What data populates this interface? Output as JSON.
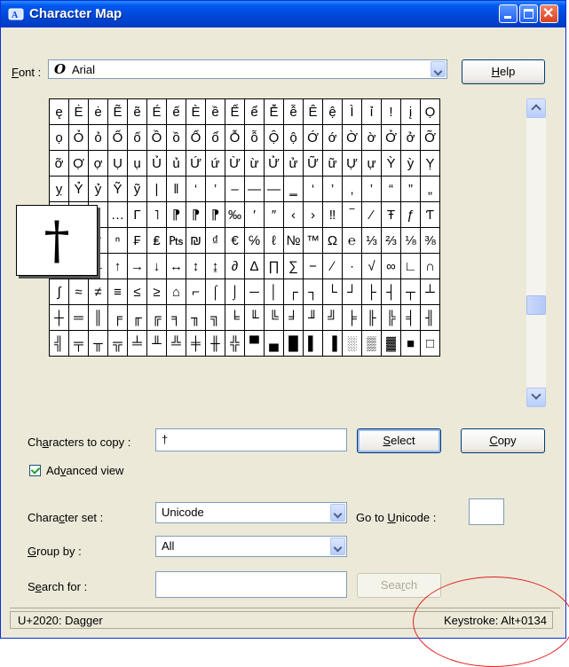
{
  "window": {
    "title": "Character Map",
    "minimize_icon": "minimize-icon",
    "maximize_icon": "maximize-icon",
    "close_icon": "close-icon"
  },
  "font": {
    "label_underlined": "F",
    "label_rest": "ont :",
    "value": "Arial",
    "help_button": {
      "underlined": "H",
      "rest": "elp"
    }
  },
  "grid": {
    "rows": [
      [
        "ę",
        "Ė",
        "ė",
        "Ẽ",
        "ẽ",
        "É",
        "ế",
        "È",
        "ề",
        "Ể",
        "ể",
        "Ễ",
        "ễ",
        "Ê",
        "ệ",
        "Ì",
        "ỉ",
        "!",
        "į",
        "Ọ"
      ],
      [
        "ọ",
        "Ỏ",
        "ỏ",
        "Ố",
        "ố",
        "Ồ",
        "ồ",
        "Ổ",
        "ổ",
        "Ỗ",
        "ỗ",
        "Ộ",
        "ộ",
        "Ớ",
        "ớ",
        "Ờ",
        "ờ",
        "Ở",
        "ở",
        "Ỡ"
      ],
      [
        "ỡ",
        "Ợ",
        "ợ",
        "Ụ",
        "ụ",
        "Ủ",
        "ủ",
        "Ứ",
        "ứ",
        "Ừ",
        "ừ",
        "Ử",
        "ử",
        "Ữ",
        "ữ",
        "Ự",
        "ự",
        "Ỳ",
        "ỳ",
        "Ỵ"
      ],
      [
        "ỵ",
        "Ỷ",
        "ỷ",
        "Ỹ",
        "ỹ",
        "|",
        "‖",
        "‘",
        "’",
        "–",
        "—",
        "―",
        "‗",
        "‘",
        "’",
        "‚",
        "‛",
        "“",
        "”",
        "„"
      ],
      [
        "‛",
        "†",
        "•",
        "…",
        "Γ",
        "˥",
        "⁋",
        "⁋",
        "⁋",
        "‰",
        "′",
        "″",
        "‹",
        "›",
        "‼",
        "‾",
        "⁄",
        "Ŧ",
        "ƒ",
        "Ƭ"
      ],
      [
        "†",
        "†",
        "†",
        "ⁿ",
        "₣",
        "₤",
        "₧",
        "₪",
        "₫",
        "€",
        "℅",
        "ℓ",
        "№",
        "™",
        "Ω",
        "℮",
        "⅓",
        "⅔",
        "⅛",
        "⅜"
      ],
      [
        "⅝",
        "⅞",
        "←",
        "↑",
        "→",
        "↓",
        "↔",
        "↕",
        "↨",
        "∂",
        "∆",
        "∏",
        "∑",
        "−",
        "∕",
        "∙",
        "√",
        "∞",
        "∟",
        "∩"
      ],
      [
        "∫",
        "≈",
        "≠",
        "≡",
        "≤",
        "≥",
        "⌂",
        "⌐",
        "⌠",
        "⌡",
        "─",
        "│",
        "┌",
        "┐",
        "└",
        "┘",
        "├",
        "┤",
        "┬",
        "┴"
      ],
      [
        "┼",
        "═",
        "║",
        "╒",
        "╓",
        "╔",
        "╕",
        "╖",
        "╗",
        "╘",
        "╙",
        "╚",
        "╛",
        "╜",
        "╝",
        "╞",
        "╟",
        "╠",
        "╡",
        "╢"
      ],
      [
        "╣",
        "╤",
        "╥",
        "╦",
        "╧",
        "╨",
        "╩",
        "╪",
        "╫",
        "╬",
        "▀",
        "▄",
        "█",
        "▌",
        "▐",
        "░",
        "▒",
        "▓",
        "■",
        "□"
      ]
    ],
    "magnified_char": "†"
  },
  "copy": {
    "label_pre": "Ch",
    "label_u": "a",
    "label_post": "racters to copy :",
    "value": "†",
    "select_button": {
      "underlined": "S",
      "rest": "elect"
    },
    "copy_button": {
      "underlined": "C",
      "rest": "opy"
    }
  },
  "advanced": {
    "pre": "Ad",
    "u": "v",
    "post": "anced view",
    "checked": true
  },
  "charset": {
    "pre": "Chara",
    "u": "c",
    "post": "ter set :",
    "value": "Unicode"
  },
  "goto": {
    "pre": "Go to ",
    "u": "U",
    "post": "nicode :",
    "value": ""
  },
  "groupby": {
    "u": "G",
    "post": "roup by :",
    "value": "All"
  },
  "search": {
    "pre": "S",
    "u": "e",
    "post": "arch for :",
    "value": "",
    "button": {
      "pre": "Sea",
      "u": "r",
      "post": "ch"
    }
  },
  "status": {
    "left": "U+2020: Dagger",
    "right": "Keystroke: Alt+0134"
  },
  "annotation_color": "#e02020",
  "accent_color": "#0058ee"
}
